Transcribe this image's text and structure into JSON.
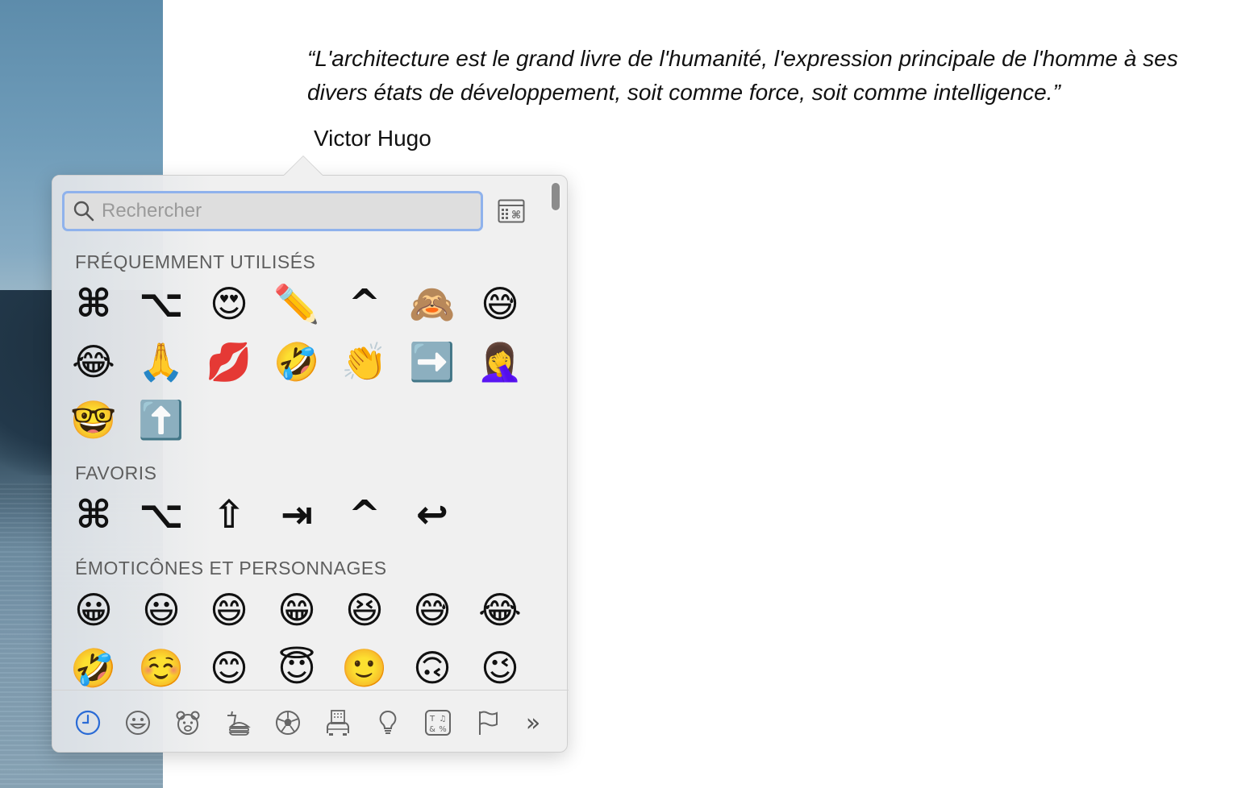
{
  "document": {
    "quote": "“L'architecture est le grand livre de l'humanité, l'expression principale de l'homme à ses divers états de développement, soit comme force, soit comme intelligence.”",
    "author": "Victor Hugo"
  },
  "picker": {
    "search": {
      "placeholder": "Rechercher",
      "value": ""
    },
    "sections": [
      {
        "title": "FRÉQUEMMENT UTILISÉS",
        "items": [
          "⌘",
          "⌥",
          "😍",
          "✏️",
          "^",
          "🙈",
          "😅",
          "😂",
          "🙏",
          "💋",
          "🤣",
          "👏",
          "➡️",
          "🤦‍♀️",
          "🤓",
          "⬆️"
        ]
      },
      {
        "title": "FAVORIS",
        "items": [
          "⌘",
          "⌥",
          "⇧",
          "⇥",
          "^",
          "↩"
        ]
      },
      {
        "title": "ÉMOTICÔNES ET PERSONNAGES",
        "items": [
          "😀",
          "😃",
          "😄",
          "😁",
          "😆",
          "😅",
          "😂",
          "🤣",
          "☺️",
          "😊",
          "😇",
          "🙂",
          "🙃",
          "😉"
        ]
      }
    ],
    "tabs": [
      "recent-icon",
      "smiley-icon",
      "animal-icon",
      "food-icon",
      "ball-icon",
      "building-icon",
      "lightbulb-icon",
      "symbols-icon",
      "flag-icon"
    ],
    "more_label": "»",
    "accent_color": "#2a6bd6"
  }
}
